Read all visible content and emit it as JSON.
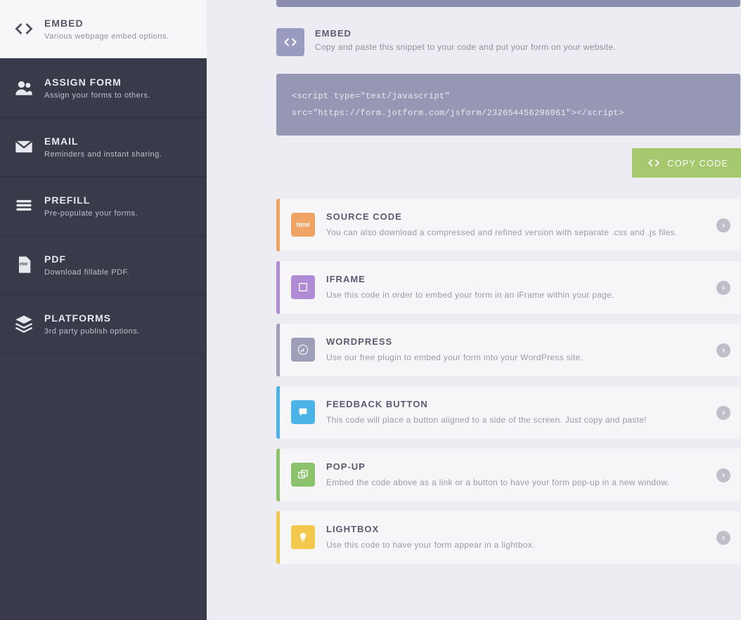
{
  "sidebar": {
    "items": [
      {
        "title": "EMBED",
        "subtitle": "Various webpage embed options."
      },
      {
        "title": "ASSIGN FORM",
        "subtitle": "Assign your forms to others."
      },
      {
        "title": "EMAIL",
        "subtitle": "Reminders and instant sharing."
      },
      {
        "title": "PREFILL",
        "subtitle": "Pre-populate your forms."
      },
      {
        "title": "PDF",
        "subtitle": "Download fillable PDF."
      },
      {
        "title": "PLATFORMS",
        "subtitle": "3rd party publish options."
      }
    ]
  },
  "embed": {
    "title": "EMBED",
    "subtitle": "Copy and paste this snippet to your code and put your form on your website.",
    "code": "<script type=\"text/javascript\" src=\"https://form.jotform.com/jsform/232654456296061\"></script>",
    "copy_label": "COPY CODE"
  },
  "options": [
    {
      "title": "SOURCE CODE",
      "subtitle": "You can also download a compressed and refined version with separate .css and .js files.",
      "stripe": "#f0a464",
      "icon_bg": "#f0a464",
      "icon": "html"
    },
    {
      "title": "IFRAME",
      "subtitle": "Use this code in order to embed your form in an iFrame within your page.",
      "stripe": "#b18bd6",
      "icon_bg": "#b18bd6",
      "icon": "frame"
    },
    {
      "title": "WORDPRESS",
      "subtitle": "Use our free plugin to embed your form into your WordPress site.",
      "stripe": "#9ea0b9",
      "icon_bg": "#9ea0b9",
      "icon": "wordpress"
    },
    {
      "title": "FEEDBACK BUTTON",
      "subtitle": "This code will place a button aligned to a side of the screen. Just copy and paste!",
      "stripe": "#4cb3e6",
      "icon_bg": "#4cb3e6",
      "icon": "chat"
    },
    {
      "title": "POP-UP",
      "subtitle": "Embed the code above as a link or a button to have your form pop-up in a new window.",
      "stripe": "#8cc26b",
      "icon_bg": "#8cc26b",
      "icon": "popup"
    },
    {
      "title": "LIGHTBOX",
      "subtitle": "Use this code to have your form appear in a lightbox.",
      "stripe": "#f2c94c",
      "icon_bg": "#f2c94c",
      "icon": "bulb"
    }
  ]
}
